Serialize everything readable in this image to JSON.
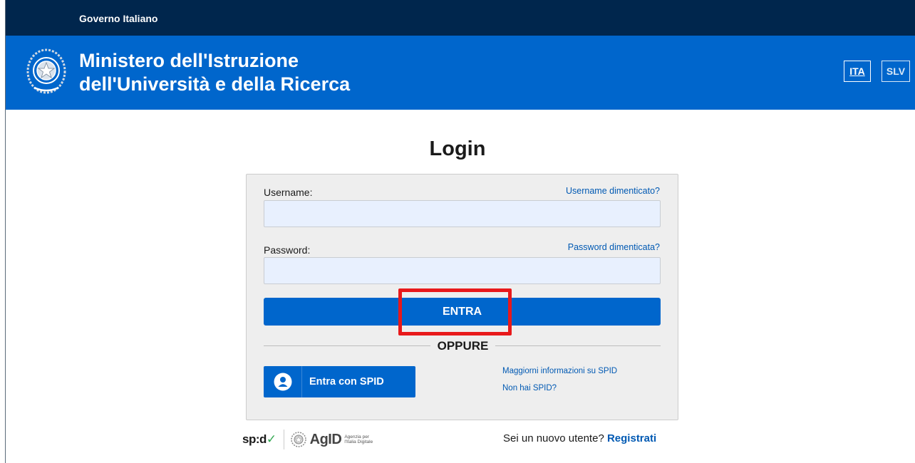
{
  "top_bar": {
    "government": "Governo Italiano"
  },
  "header": {
    "ministry_line1": "Ministero dell'Istruzione",
    "ministry_line2": "dell'Università e della Ricerca",
    "languages": [
      "ITA",
      "SLV"
    ],
    "active_language": "ITA"
  },
  "login": {
    "title": "Login",
    "username_label": "Username:",
    "username_forgot": "Username dimenticato?",
    "username_value": "",
    "password_label": "Password:",
    "password_forgot": "Password dimenticata?",
    "password_value": "",
    "submit_label": "ENTRA",
    "or_label": "OPPURE",
    "spid_button_label": "Entra con SPID",
    "spid_info_link": "Maggiorni informazioni su SPID",
    "spid_no_link": "Non hai SPID?"
  },
  "footer": {
    "spid_logo": "sp:d",
    "agid_logo": "AgID",
    "agid_sub_line1": "Agenzia per",
    "agid_sub_line2": "l'Italia Digitale",
    "new_user_text": "Sei un nuovo utente?",
    "register_link": "Registrati"
  },
  "colors": {
    "top_bar": "#00264d",
    "header": "#0066cc",
    "primary_button": "#0066cc",
    "link": "#0059b3",
    "highlight_box": "#e8191b"
  },
  "icons": [
    "republic-emblem-icon",
    "user-icon",
    "spid-check-icon",
    "agid-emblem-icon"
  ]
}
